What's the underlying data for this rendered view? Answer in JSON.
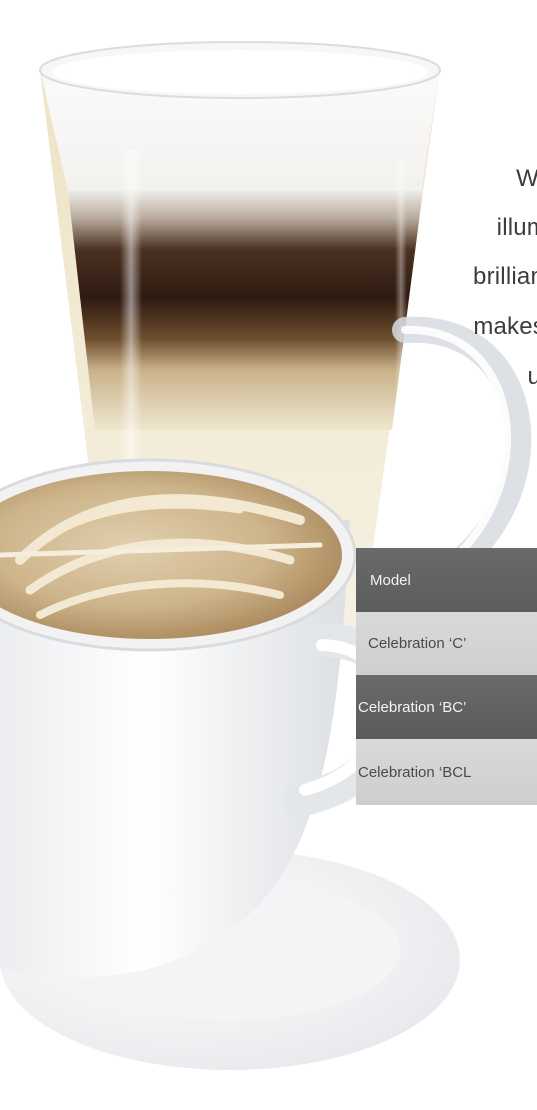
{
  "paragraph": {
    "lines": [
      "W",
      "illum",
      "brillian",
      "makes",
      "u"
    ]
  },
  "spec_table": {
    "header": "Model",
    "rows": [
      "Celebration ‘C’",
      "Celebration ‘BC’",
      "Celebration ‘BCL"
    ]
  },
  "colors": {
    "table_header": "#5f5f5f",
    "table_light": "#d4d4d4",
    "table_dark": "#606060",
    "coffee_dark": "#3b2418",
    "milk": "#efe6cf"
  },
  "icons": {
    "photo": "latte-glass-and-cappuccino-cup-photo"
  }
}
